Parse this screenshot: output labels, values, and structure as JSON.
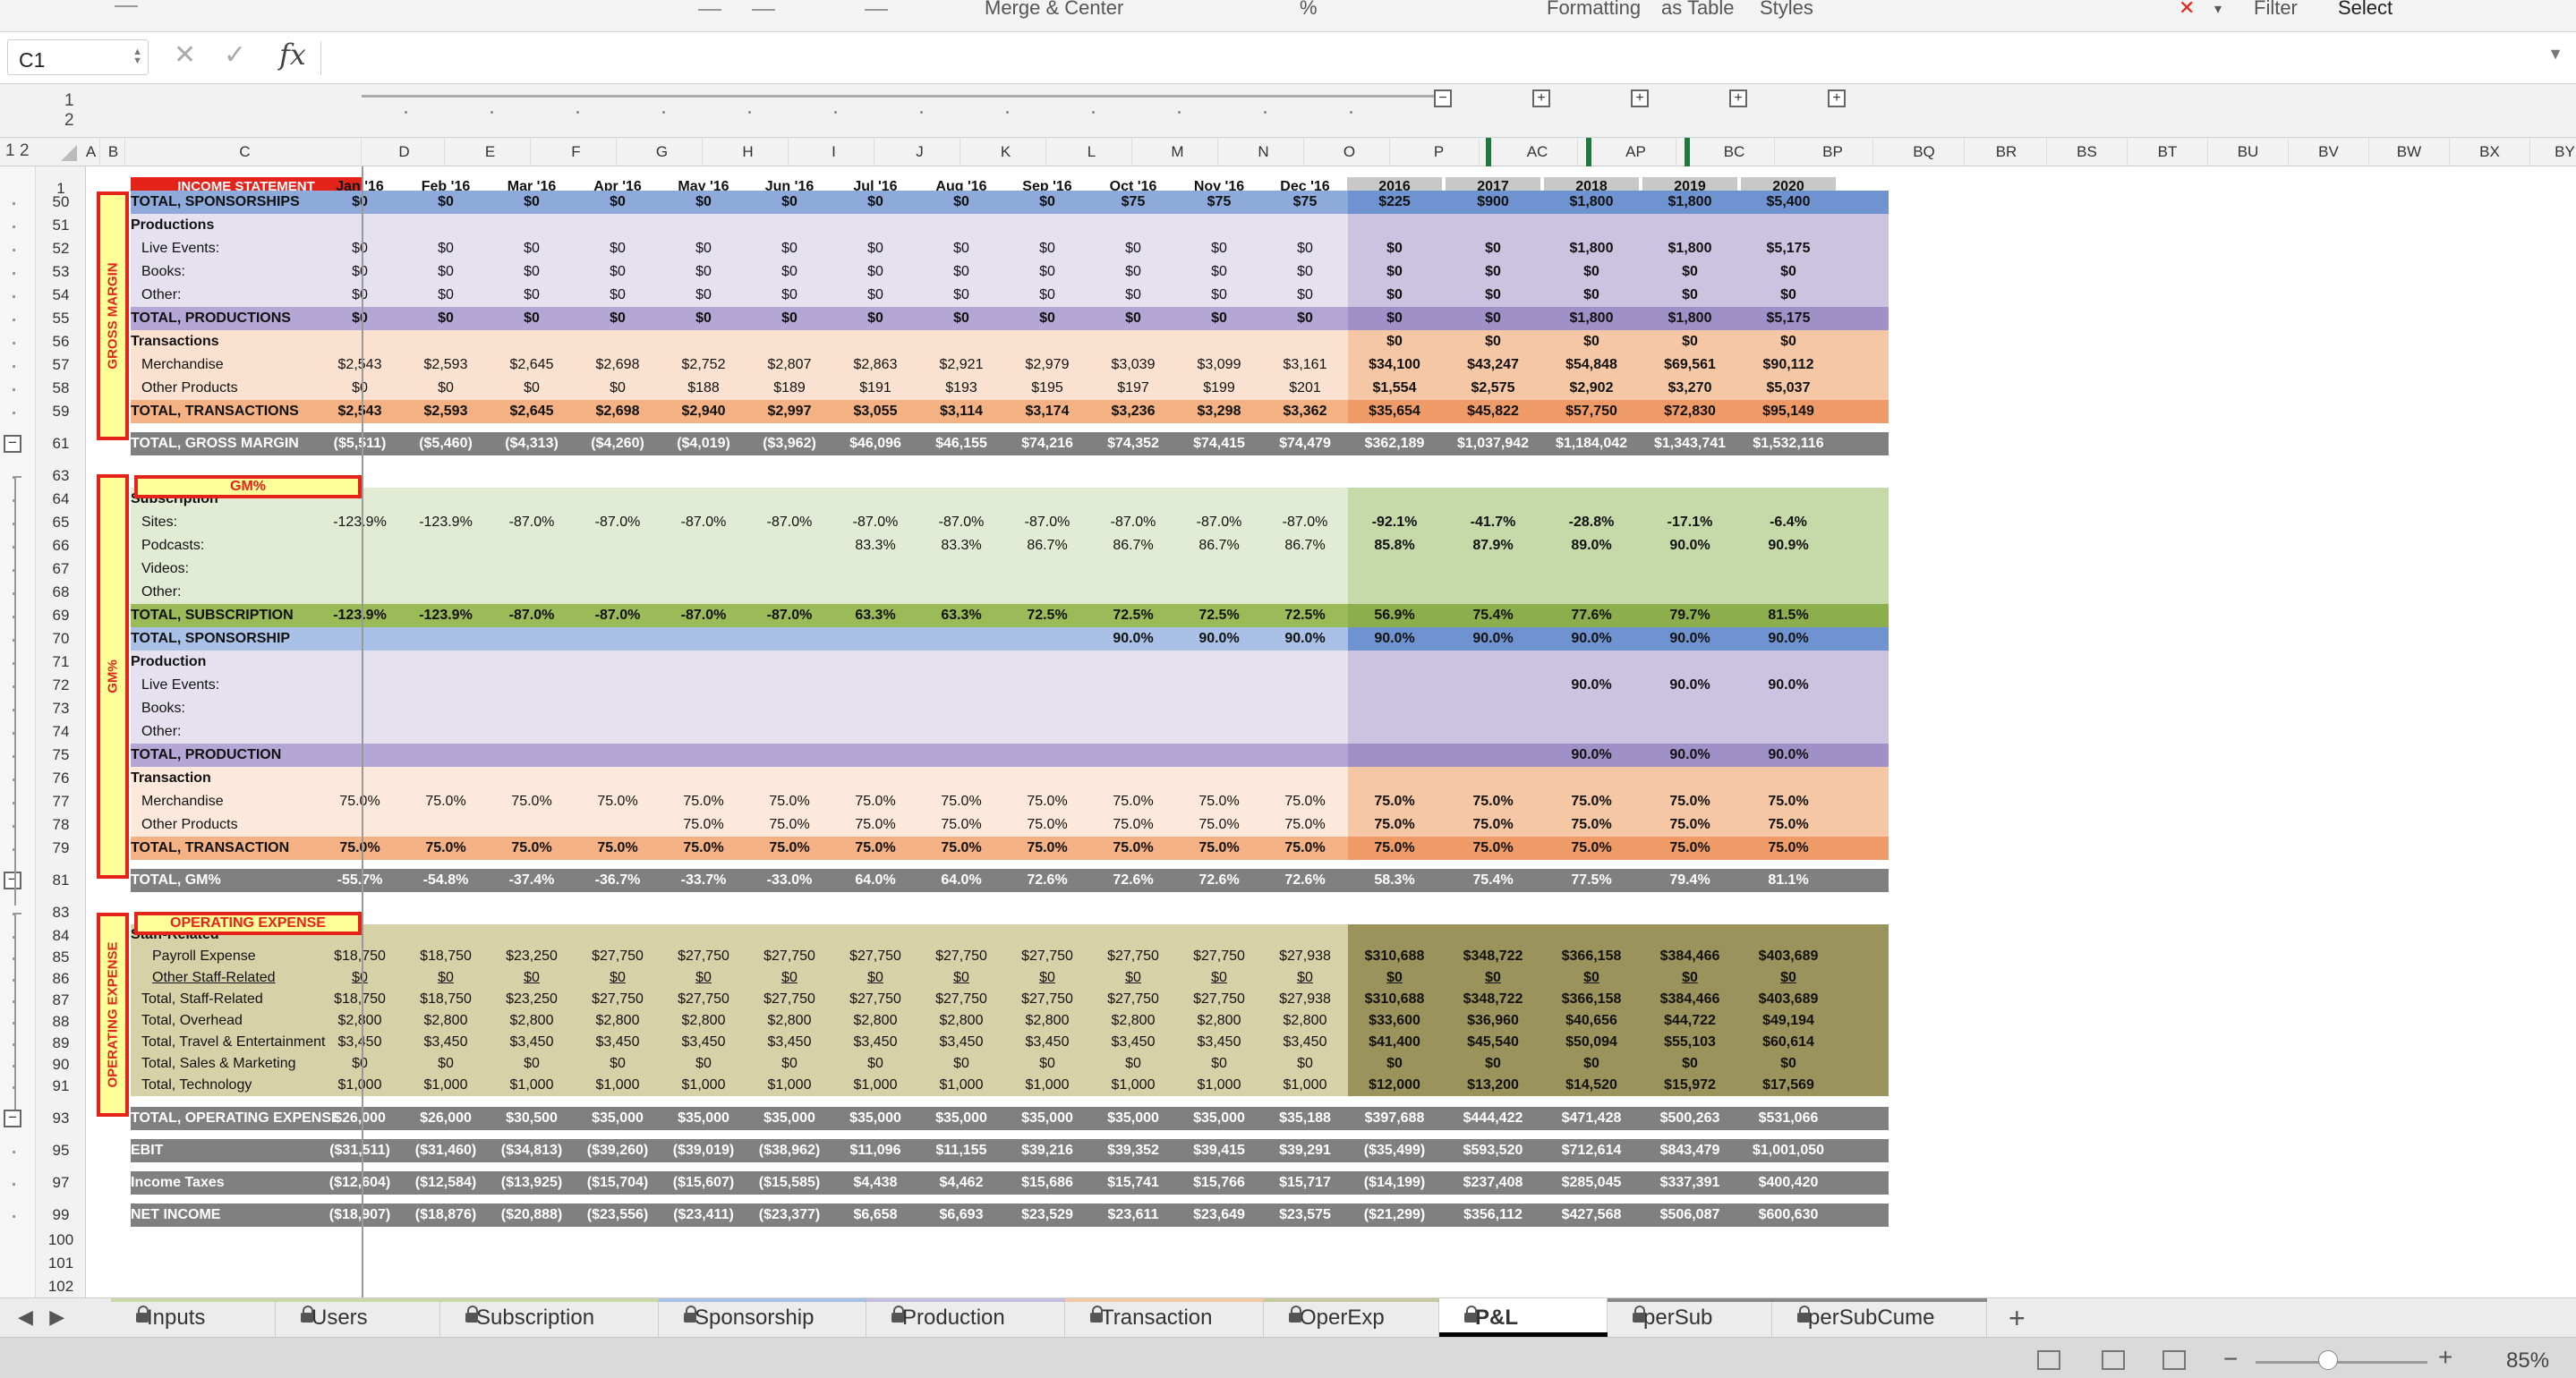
{
  "ribbon": {
    "formatting": "Formatting",
    "as_table": "as Table",
    "styles": "Styles",
    "filter": "Filter",
    "select": "Select",
    "merge": "Merge & Center"
  },
  "formula_bar": {
    "name_box": "C1",
    "fx": "fx",
    "formula": ""
  },
  "outline_levels": [
    "1",
    "2"
  ],
  "columns": [
    "A",
    "B",
    "C",
    "D",
    "E",
    "F",
    "G",
    "H",
    "I",
    "J",
    "K",
    "L",
    "M",
    "N",
    "O",
    "P",
    "AC",
    "AP",
    "BC",
    "BP",
    "BQ",
    "BR",
    "BS",
    "BT",
    "BU",
    "BV",
    "BW",
    "BX",
    "BY"
  ],
  "header": {
    "title": "INCOME STATEMENT",
    "months": [
      "Jan '16",
      "Feb '16",
      "Mar '16",
      "Apr '16",
      "May '16",
      "Jun '16",
      "Jul '16",
      "Aug '16",
      "Sep '16",
      "Oct '16",
      "Nov '16",
      "Dec '16"
    ],
    "years": [
      "2016",
      "2017",
      "2018",
      "2019",
      "2020"
    ]
  },
  "section_labels": {
    "gross_margin": "GROSS MARGIN",
    "gm_pct": "GM%",
    "opex": "OPERATING EXPENSE"
  },
  "rows": [
    {
      "n": "50",
      "label": "TOTAL, SPONSORSHIPS",
      "vals": [
        "$0",
        "$0",
        "$0",
        "$0",
        "$0",
        "$0",
        "$0",
        "$0",
        "$0",
        "$75",
        "$75",
        "$75",
        "$225",
        "$900",
        "$1,800",
        "$1,800",
        "$5,400"
      ]
    },
    {
      "n": "51",
      "label": "Productions",
      "vals": []
    },
    {
      "n": "52",
      "label": "Live Events:",
      "vals": [
        "$0",
        "$0",
        "$0",
        "$0",
        "$0",
        "$0",
        "$0",
        "$0",
        "$0",
        "$0",
        "$0",
        "$0",
        "$0",
        "$0",
        "$1,800",
        "$1,800",
        "$5,175"
      ]
    },
    {
      "n": "53",
      "label": "Books:",
      "vals": [
        "$0",
        "$0",
        "$0",
        "$0",
        "$0",
        "$0",
        "$0",
        "$0",
        "$0",
        "$0",
        "$0",
        "$0",
        "$0",
        "$0",
        "$0",
        "$0",
        "$0"
      ]
    },
    {
      "n": "54",
      "label": "Other:",
      "vals": [
        "$0",
        "$0",
        "$0",
        "$0",
        "$0",
        "$0",
        "$0",
        "$0",
        "$0",
        "$0",
        "$0",
        "$0",
        "$0",
        "$0",
        "$0",
        "$0",
        "$0"
      ]
    },
    {
      "n": "55",
      "label": "TOTAL, PRODUCTIONS",
      "vals": [
        "$0",
        "$0",
        "$0",
        "$0",
        "$0",
        "$0",
        "$0",
        "$0",
        "$0",
        "$0",
        "$0",
        "$0",
        "$0",
        "$0",
        "$1,800",
        "$1,800",
        "$5,175"
      ]
    },
    {
      "n": "56",
      "label": "Transactions",
      "vals": [
        "",
        "",
        "",
        "",
        "",
        "",
        "",
        "",
        "",
        "",
        "",
        "",
        "$0",
        "$0",
        "$0",
        "$0",
        "$0"
      ]
    },
    {
      "n": "57",
      "label": "Merchandise",
      "vals": [
        "$2,543",
        "$2,593",
        "$2,645",
        "$2,698",
        "$2,752",
        "$2,807",
        "$2,863",
        "$2,921",
        "$2,979",
        "$3,039",
        "$3,099",
        "$3,161",
        "$34,100",
        "$43,247",
        "$54,848",
        "$69,561",
        "$90,112"
      ]
    },
    {
      "n": "58",
      "label": "Other Products",
      "vals": [
        "$0",
        "$0",
        "$0",
        "$0",
        "$188",
        "$189",
        "$191",
        "$193",
        "$195",
        "$197",
        "$199",
        "$201",
        "$1,554",
        "$2,575",
        "$2,902",
        "$3,270",
        "$5,037"
      ]
    },
    {
      "n": "59",
      "label": "TOTAL, TRANSACTIONS",
      "vals": [
        "$2,543",
        "$2,593",
        "$2,645",
        "$2,698",
        "$2,940",
        "$2,997",
        "$3,055",
        "$3,114",
        "$3,174",
        "$3,236",
        "$3,298",
        "$3,362",
        "$35,654",
        "$45,822",
        "$57,750",
        "$72,830",
        "$95,149"
      ]
    },
    {
      "n": "61",
      "label": "TOTAL, GROSS MARGIN",
      "vals": [
        "($5,511)",
        "($5,460)",
        "($4,313)",
        "($4,260)",
        "($4,019)",
        "($3,962)",
        "$46,096",
        "$46,155",
        "$74,216",
        "$74,352",
        "$74,415",
        "$74,479",
        "$362,189",
        "$1,037,942",
        "$1,184,042",
        "$1,343,741",
        "$1,532,116"
      ]
    },
    {
      "n": "63",
      "label": "",
      "vals": []
    },
    {
      "n": "64",
      "label": "Subscription",
      "vals": []
    },
    {
      "n": "65",
      "label": "Sites:",
      "vals": [
        "-123.9%",
        "-123.9%",
        "-87.0%",
        "-87.0%",
        "-87.0%",
        "-87.0%",
        "-87.0%",
        "-87.0%",
        "-87.0%",
        "-87.0%",
        "-87.0%",
        "-87.0%",
        "-92.1%",
        "-41.7%",
        "-28.8%",
        "-17.1%",
        "-6.4%"
      ]
    },
    {
      "n": "66",
      "label": "Podcasts:",
      "vals": [
        "",
        "",
        "",
        "",
        "",
        "",
        "83.3%",
        "83.3%",
        "86.7%",
        "86.7%",
        "86.7%",
        "86.7%",
        "85.8%",
        "87.9%",
        "89.0%",
        "90.0%",
        "90.9%"
      ]
    },
    {
      "n": "67",
      "label": "Videos:",
      "vals": []
    },
    {
      "n": "68",
      "label": "Other:",
      "vals": []
    },
    {
      "n": "69",
      "label": "TOTAL, SUBSCRIPTION",
      "vals": [
        "-123.9%",
        "-123.9%",
        "-87.0%",
        "-87.0%",
        "-87.0%",
        "-87.0%",
        "63.3%",
        "63.3%",
        "72.5%",
        "72.5%",
        "72.5%",
        "72.5%",
        "56.9%",
        "75.4%",
        "77.6%",
        "79.7%",
        "81.5%"
      ]
    },
    {
      "n": "70",
      "label": "TOTAL, SPONSORSHIP",
      "vals": [
        "",
        "",
        "",
        "",
        "",
        "",
        "",
        "",
        "",
        "90.0%",
        "90.0%",
        "90.0%",
        "90.0%",
        "90.0%",
        "90.0%",
        "90.0%",
        "90.0%"
      ]
    },
    {
      "n": "71",
      "label": "Production",
      "vals": []
    },
    {
      "n": "72",
      "label": "Live Events:",
      "vals": [
        "",
        "",
        "",
        "",
        "",
        "",
        "",
        "",
        "",
        "",
        "",
        "",
        "",
        "",
        "90.0%",
        "90.0%",
        "90.0%"
      ]
    },
    {
      "n": "73",
      "label": "Books:",
      "vals": []
    },
    {
      "n": "74",
      "label": "Other:",
      "vals": []
    },
    {
      "n": "75",
      "label": "TOTAL, PRODUCTION",
      "vals": [
        "",
        "",
        "",
        "",
        "",
        "",
        "",
        "",
        "",
        "",
        "",
        "",
        "",
        "",
        "90.0%",
        "90.0%",
        "90.0%"
      ]
    },
    {
      "n": "76",
      "label": "Transaction",
      "vals": []
    },
    {
      "n": "77",
      "label": "Merchandise",
      "vals": [
        "75.0%",
        "75.0%",
        "75.0%",
        "75.0%",
        "75.0%",
        "75.0%",
        "75.0%",
        "75.0%",
        "75.0%",
        "75.0%",
        "75.0%",
        "75.0%",
        "75.0%",
        "75.0%",
        "75.0%",
        "75.0%",
        "75.0%"
      ]
    },
    {
      "n": "78",
      "label": "Other Products",
      "vals": [
        "",
        "",
        "",
        "",
        "75.0%",
        "75.0%",
        "75.0%",
        "75.0%",
        "75.0%",
        "75.0%",
        "75.0%",
        "75.0%",
        "75.0%",
        "75.0%",
        "75.0%",
        "75.0%",
        "75.0%"
      ]
    },
    {
      "n": "79",
      "label": "TOTAL, TRANSACTION",
      "vals": [
        "75.0%",
        "75.0%",
        "75.0%",
        "75.0%",
        "75.0%",
        "75.0%",
        "75.0%",
        "75.0%",
        "75.0%",
        "75.0%",
        "75.0%",
        "75.0%",
        "75.0%",
        "75.0%",
        "75.0%",
        "75.0%",
        "75.0%"
      ]
    },
    {
      "n": "81",
      "label": "TOTAL, GM%",
      "vals": [
        "-55.7%",
        "-54.8%",
        "-37.4%",
        "-36.7%",
        "-33.7%",
        "-33.0%",
        "64.0%",
        "64.0%",
        "72.6%",
        "72.6%",
        "72.6%",
        "72.6%",
        "58.3%",
        "75.4%",
        "77.5%",
        "79.4%",
        "81.1%"
      ]
    },
    {
      "n": "83",
      "label": "",
      "vals": []
    },
    {
      "n": "84",
      "label": "Staff-Related",
      "vals": []
    },
    {
      "n": "85",
      "label": "Payroll Expense",
      "vals": [
        "$18,750",
        "$18,750",
        "$23,250",
        "$27,750",
        "$27,750",
        "$27,750",
        "$27,750",
        "$27,750",
        "$27,750",
        "$27,750",
        "$27,750",
        "$27,938",
        "$310,688",
        "$348,722",
        "$366,158",
        "$384,466",
        "$403,689"
      ]
    },
    {
      "n": "86",
      "label": "Other Staff-Related",
      "vals": [
        "$0",
        "$0",
        "$0",
        "$0",
        "$0",
        "$0",
        "$0",
        "$0",
        "$0",
        "$0",
        "$0",
        "$0",
        "$0",
        "$0",
        "$0",
        "$0",
        "$0"
      ]
    },
    {
      "n": "87",
      "label": "Total, Staff-Related",
      "vals": [
        "$18,750",
        "$18,750",
        "$23,250",
        "$27,750",
        "$27,750",
        "$27,750",
        "$27,750",
        "$27,750",
        "$27,750",
        "$27,750",
        "$27,750",
        "$27,938",
        "$310,688",
        "$348,722",
        "$366,158",
        "$384,466",
        "$403,689"
      ]
    },
    {
      "n": "88",
      "label": "Total, Overhead",
      "vals": [
        "$2,800",
        "$2,800",
        "$2,800",
        "$2,800",
        "$2,800",
        "$2,800",
        "$2,800",
        "$2,800",
        "$2,800",
        "$2,800",
        "$2,800",
        "$2,800",
        "$33,600",
        "$36,960",
        "$40,656",
        "$44,722",
        "$49,194"
      ]
    },
    {
      "n": "89",
      "label": "Total, Travel & Entertainment",
      "vals": [
        "$3,450",
        "$3,450",
        "$3,450",
        "$3,450",
        "$3,450",
        "$3,450",
        "$3,450",
        "$3,450",
        "$3,450",
        "$3,450",
        "$3,450",
        "$3,450",
        "$41,400",
        "$45,540",
        "$50,094",
        "$55,103",
        "$60,614"
      ]
    },
    {
      "n": "90",
      "label": "Total, Sales & Marketing",
      "vals": [
        "$0",
        "$0",
        "$0",
        "$0",
        "$0",
        "$0",
        "$0",
        "$0",
        "$0",
        "$0",
        "$0",
        "$0",
        "$0",
        "$0",
        "$0",
        "$0",
        "$0"
      ]
    },
    {
      "n": "91",
      "label": "Total, Technology",
      "vals": [
        "$1,000",
        "$1,000",
        "$1,000",
        "$1,000",
        "$1,000",
        "$1,000",
        "$1,000",
        "$1,000",
        "$1,000",
        "$1,000",
        "$1,000",
        "$1,000",
        "$12,000",
        "$13,200",
        "$14,520",
        "$15,972",
        "$17,569"
      ]
    },
    {
      "n": "93",
      "label": "TOTAL, OPERATING EXPENSE",
      "vals": [
        "$26,000",
        "$26,000",
        "$30,500",
        "$35,000",
        "$35,000",
        "$35,000",
        "$35,000",
        "$35,000",
        "$35,000",
        "$35,000",
        "$35,000",
        "$35,188",
        "$397,688",
        "$444,422",
        "$471,428",
        "$500,263",
        "$531,066"
      ]
    },
    {
      "n": "95",
      "label": "EBIT",
      "vals": [
        "($31,511)",
        "($31,460)",
        "($34,813)",
        "($39,260)",
        "($39,019)",
        "($38,962)",
        "$11,096",
        "$11,155",
        "$39,216",
        "$39,352",
        "$39,415",
        "$39,291",
        "($35,499)",
        "$593,520",
        "$712,614",
        "$843,479",
        "$1,001,050"
      ]
    },
    {
      "n": "97",
      "label": "Income Taxes",
      "vals": [
        "($12,604)",
        "($12,584)",
        "($13,925)",
        "($15,704)",
        "($15,607)",
        "($15,585)",
        "$4,438",
        "$4,462",
        "$15,686",
        "$15,741",
        "$15,766",
        "$15,717",
        "($14,199)",
        "$237,408",
        "$285,045",
        "$337,391",
        "$400,420"
      ]
    },
    {
      "n": "99",
      "label": "NET INCOME",
      "vals": [
        "($18,907)",
        "($18,876)",
        "($20,888)",
        "($23,556)",
        "($23,411)",
        "($23,377)",
        "$6,658",
        "$6,693",
        "$23,529",
        "$23,611",
        "$23,649",
        "$23,575",
        "($21,299)",
        "$356,112",
        "$427,568",
        "$506,087",
        "$600,630"
      ]
    },
    {
      "n": "100",
      "label": "",
      "vals": []
    },
    {
      "n": "101",
      "label": "",
      "vals": []
    },
    {
      "n": "102",
      "label": "",
      "vals": []
    }
  ],
  "tabs": [
    "Inputs",
    "Users",
    "Subscription",
    "Sponsorship",
    "Production",
    "Transaction",
    "OperExp",
    "P&L",
    "perSub",
    "perSubCume"
  ],
  "active_tab": "P&L",
  "tab_colors": [
    "#c9d8a8",
    "#c9d8a8",
    "#c9d8a8",
    "#a9bfe3",
    "#c4bddc",
    "#f3c8a4",
    "#c8c8a0",
    "#000000",
    "#888888",
    "#888888"
  ],
  "status": {
    "zoom": "85%"
  },
  "colors": {
    "green": "#e2ebd3",
    "green_total": "#9bbb59",
    "blue": "#8eaadb",
    "purple": "#e6e1ef",
    "purple_total": "#b4a7d6",
    "orange": "#fbe2d0",
    "orange_total": "#f4b183",
    "olive": "#b7b07a",
    "olive_light": "#d7d1a8",
    "gray": "#808080",
    "accent": "#e4231b"
  }
}
